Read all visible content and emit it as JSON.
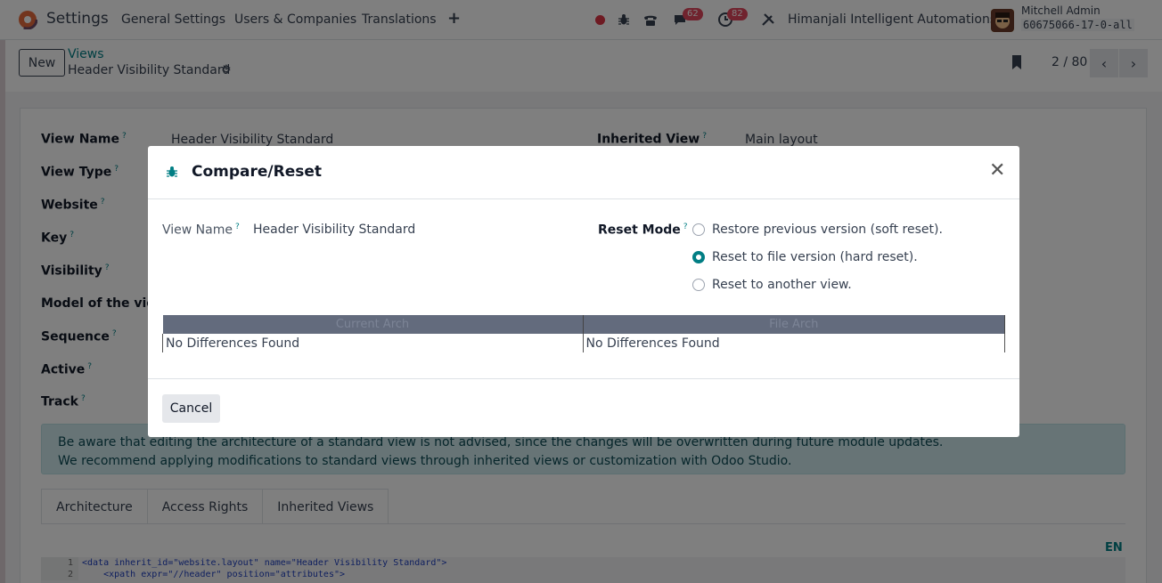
{
  "navbar": {
    "app_name": "Settings",
    "menus": [
      "General Settings",
      "Users & Companies",
      "Translations"
    ],
    "plus": "+",
    "messages_count": "62",
    "activities_count": "82",
    "company": "Himanjali Intelligent Automations",
    "user_name": "Mitchell Admin",
    "db_name": "60675066-17-0-all"
  },
  "control_panel": {
    "new_label": "New",
    "breadcrumb_parent": "Views",
    "breadcrumb_current": "Header Visibility Standard",
    "pager": "2 / 80"
  },
  "form": {
    "left_fields": [
      {
        "label": "View Name",
        "value": "Header Visibility Standard"
      },
      {
        "label": "View Type",
        "value": ""
      },
      {
        "label": "Website",
        "value": ""
      },
      {
        "label": "Key",
        "value": ""
      },
      {
        "label": "Visibility",
        "value": ""
      },
      {
        "label": "Model of the view",
        "value": ""
      },
      {
        "label": "Sequence",
        "value": ""
      },
      {
        "label": "Active",
        "value": ""
      },
      {
        "label": "Track",
        "value": ""
      }
    ],
    "inherited_view_label": "Inherited View",
    "inherited_view_value": "Main layout",
    "alert_line1": "Be aware that editing the architecture of a standard view is not advised, since the changes will be overwritten during future module updates.",
    "alert_line2": "We recommend applying modifications to standard views through inherited views or customization with Odoo Studio.",
    "tabs": [
      "Architecture",
      "Access Rights",
      "Inherited Views"
    ],
    "lang": "EN",
    "code_lines": [
      {
        "num": "1",
        "text": "<data inherit_id=\"website.layout\" name=\"Header Visibility Standard\">"
      },
      {
        "num": "2",
        "text": "    <xpath expr=\"//header\" position=\"attributes\">"
      }
    ]
  },
  "modal": {
    "title": "Compare/Reset",
    "view_name_label": "View Name",
    "view_name_value": "Header Visibility Standard",
    "reset_mode_label": "Reset Mode",
    "reset_options": [
      {
        "label": "Restore previous version (soft reset).",
        "checked": false
      },
      {
        "label": "Reset to file version (hard reset).",
        "checked": true
      },
      {
        "label": "Reset to another view.",
        "checked": false
      }
    ],
    "col_current": "Current Arch",
    "col_file": "File Arch",
    "current_diff": "No Differences Found",
    "file_diff": "No Differences Found",
    "cancel_label": "Cancel"
  },
  "colors": {
    "accent": "#017e84",
    "badge": "#e0475c",
    "brand": "#714b67"
  }
}
